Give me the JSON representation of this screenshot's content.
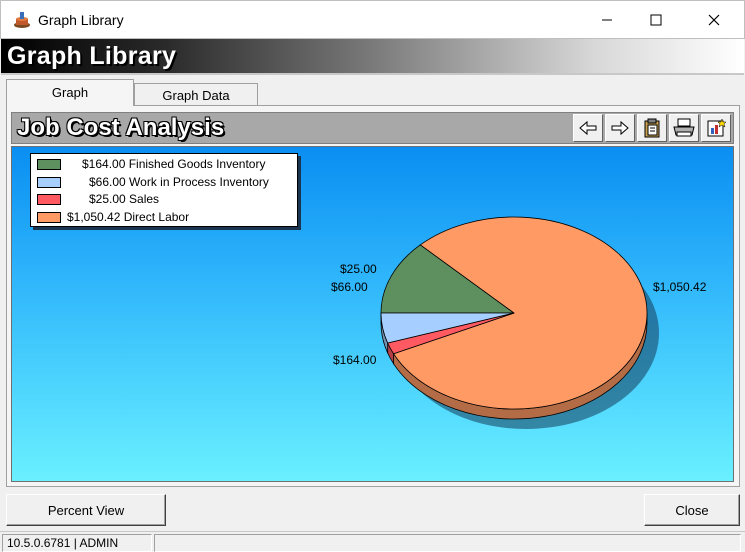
{
  "window": {
    "title": "Graph Library",
    "app_icon": "ink-stamp-icon"
  },
  "header": {
    "title": "Graph Library"
  },
  "tabs": [
    {
      "label": "Graph",
      "active": true
    },
    {
      "label": "Graph Data",
      "active": false
    }
  ],
  "chart_panel": {
    "title": "Job Cost Analysis",
    "toolbar": [
      "arrow-left-icon",
      "arrow-right-icon",
      "copy-clipboard-icon",
      "print-icon",
      "chart-wizard-icon"
    ]
  },
  "chart_data": {
    "type": "pie",
    "title": "Job Cost Analysis",
    "legend_position": "top-left",
    "slices": [
      {
        "name": "Finished Goods Inventory",
        "value": 164.0,
        "legend_text": "$164.00 Finished Goods Inventory",
        "label": "$164.00",
        "color": "#5e8f5e"
      },
      {
        "name": "Work in Process Inventory",
        "value": 66.0,
        "legend_text": "$66.00 Work in Process Inventory",
        "label": "$66.00",
        "color": "#a6cfff"
      },
      {
        "name": "Sales",
        "value": 25.0,
        "legend_text": "$25.00 Sales",
        "label": "$25.00",
        "color": "#ff5a62"
      },
      {
        "name": "Direct Labor",
        "value": 1050.42,
        "legend_text": "$1,050.42 Direct Labor",
        "label": "$1,050.42",
        "color": "#ff9a64"
      }
    ]
  },
  "buttons": {
    "percent_view": "Percent View",
    "close": "Close"
  },
  "status": {
    "text": "10.5.0.6781 | ADMIN"
  },
  "colors": {
    "plot_top": "#0a8ef2",
    "plot_bottom": "#6af0ff"
  }
}
